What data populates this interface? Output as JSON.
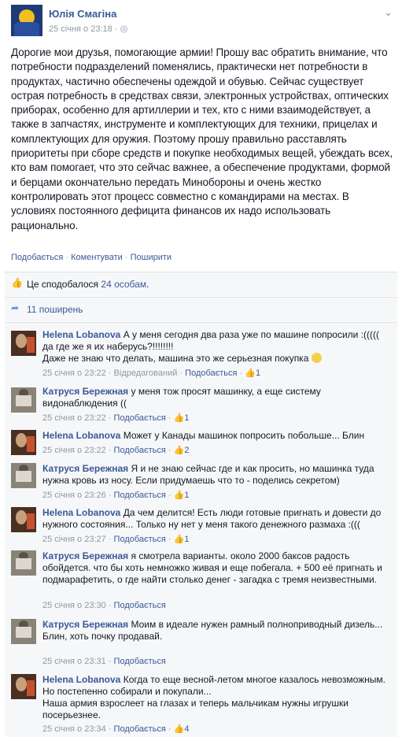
{
  "post": {
    "author": "Юлія Смагіна",
    "date": "25 січня о 23:18",
    "privacy_icon": "globe-icon",
    "menu_icon": "chevron-down-icon",
    "text": "Дорогие мои друзья, помогающие армии! Прошу вас обратить внимание, что потребности подразделений поменялись, практически нет потребности в продуктах, частично обеспечены одеждой и обувью. Сейчас существует острая потребность в средствах связи, электронных устройствах, оптических приборах, особенно для артиллерии и тех, кто с ними взаимодействует, а также в запчастях, инструменте и комплектующих для техники, прицелах и комплектующих для оружия. Поэтому прошу правильно расставлять приоритеты при сборе средств и покупке необходимых вещей, убеждать всех, кто вам помогает, что это сейчас важнее, а обеспечение продуктами, формой и берцами окончательно передать Минобороны и очень жестко контролировать этот процесс совместно с командирами на местах. В условиях постоянного дефицита финансов их надо использовать рационально."
  },
  "actions": {
    "like": "Подобається",
    "comment": "Коментувати",
    "share": "Поширити",
    "sep": " · "
  },
  "likes": {
    "prefix": "Це сподобалося ",
    "count_text": "24 особам",
    "suffix": "."
  },
  "shares": {
    "text": "11 поширень"
  },
  "labels": {
    "like": "Подобається",
    "edited": "Відредагований",
    "sep": " · "
  },
  "comments": [
    {
      "author": "Helena Lobanova",
      "text": "А у меня сегодня два раза уже по машине попросили :((((( да где же я их наберусь?!!!!!!!!",
      "text2": "Даже не знаю что делать, машина это же серьезная покупка",
      "time": "25 січня о 23:22",
      "likes": "1"
    },
    {
      "author": "Катруся Бережная",
      "text": "у меня тож просят машинку, а еще систему видонаблюдения ((",
      "time": "25 січня о 23:22",
      "likes": "1"
    },
    {
      "author": "Helena Lobanova",
      "text": "Может у Канады машинок попросить побольше... Блин",
      "time": "25 січня о 23:22",
      "likes": "2"
    },
    {
      "author": "Катруся Бережная",
      "text": "Я и не знаю сейчас где и как просить, но машинка туда нужна кровь из носу. Если придумаешь что то - поделись секретом)",
      "time": "25 січня о 23:26",
      "likes": "1"
    },
    {
      "author": "Helena Lobanova",
      "text": "Да чем делится! Есть люди готовые пригнать и довести до нужного состояния... Только ну нет у меня такого денежного размаха :(((",
      "time": "25 січня о 23:27",
      "likes": "1"
    },
    {
      "author": "Катруся Бережная",
      "text": "я смотрела варианты. около 2000 баксов радость обойдется. что бы хоть немножко живая и еще побегала. + 500 её пригнать и подмарафетить, о где найти столько денег - загадка с тремя неизвестными.",
      "time": "25 січня о 23:30"
    },
    {
      "author": "Катруся Бережная",
      "text": "Моим в идеале нужен рамный полноприводный дизель...",
      "text2": "Блин, хоть почку продавай.",
      "time": "25 січня о 23:31"
    },
    {
      "author": "Helena Lobanova",
      "text": "Когда то еще весной-летом многое казалось невозможным. Но постепенно собирали и покупали...",
      "text2": "Наша армия взрослеет на глазах и теперь мальчикам нужны игрушки посерьезнее.",
      "time": "25 січня о 23:34",
      "likes": "4"
    }
  ]
}
